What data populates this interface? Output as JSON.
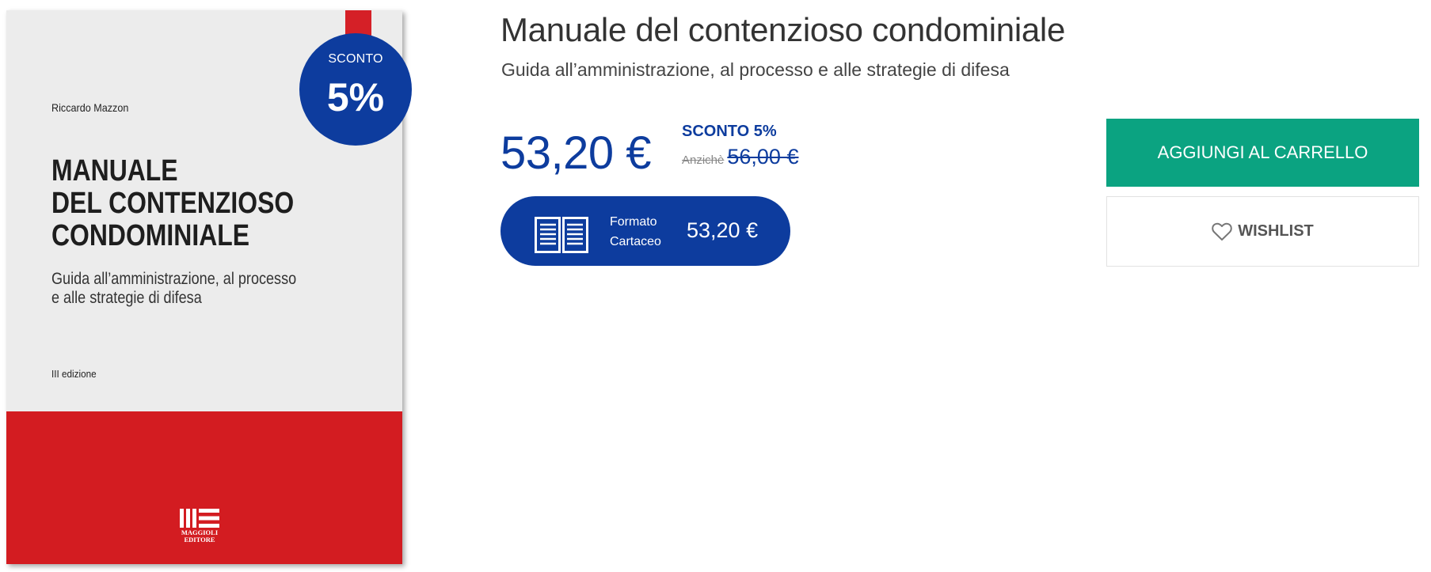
{
  "cover": {
    "author": "Riccardo Mazzon",
    "title_lines": [
      "MANUALE",
      "DEL CONTENZIOSO",
      "CONDOMINIALE"
    ],
    "subtitle_lines": [
      "Guida all’amministrazione, al processo",
      "e alle strategie di difesa"
    ],
    "edition": "III edizione",
    "publisher_logo_icon": "maggioli-editore-logo",
    "publisher_lines": [
      "MAGGIOLI",
      "EDITORE"
    ],
    "band_color": "#d31c21"
  },
  "badge": {
    "label": "SCONTO",
    "value": "5%",
    "color": "#0d3c9e"
  },
  "product": {
    "title": "Manuale del contenzioso condominiale",
    "subtitle": "Guida all’amministrazione, al processo e alle strategie di difesa"
  },
  "pricing": {
    "price": "53,20 €",
    "discount_label": "SCONTO 5%",
    "old_price_prefix": "Anzichè",
    "old_price": "56,00 €",
    "accent_color": "#0d3c9e"
  },
  "format": {
    "icon": "open-book-icon",
    "label_lines": [
      "Formato",
      "Cartaceo"
    ],
    "price": "53,20 €"
  },
  "actions": {
    "cart_label": "AGGIUNGI AL CARRELLO",
    "cart_color": "#0ba381",
    "wishlist_icon": "heart-icon",
    "wishlist_label": "WISHLIST"
  }
}
